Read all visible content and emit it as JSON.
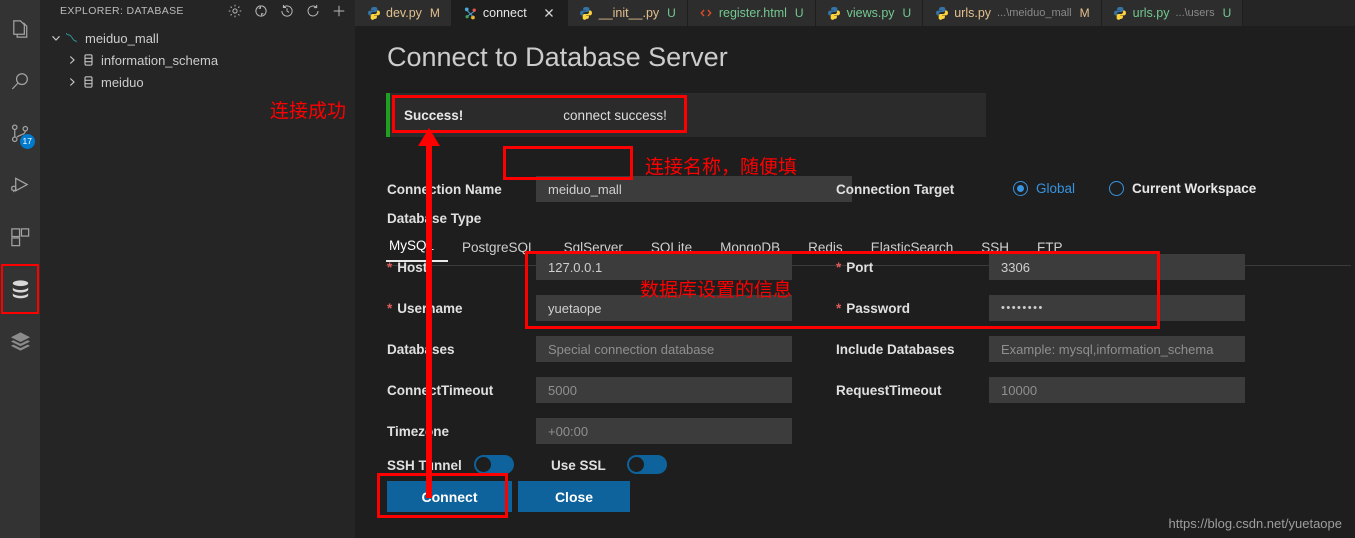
{
  "activity_bar": {
    "items": [
      {
        "name": "explorer",
        "icon": "files-icon"
      },
      {
        "name": "search",
        "icon": "search-icon"
      },
      {
        "name": "source-control",
        "icon": "source-control-icon",
        "badge": "17"
      },
      {
        "name": "run-debug",
        "icon": "run-debug-icon"
      },
      {
        "name": "extensions",
        "icon": "extensions-icon"
      },
      {
        "name": "database",
        "icon": "database-icon",
        "selected": true
      },
      {
        "name": "layers",
        "icon": "layers-icon"
      }
    ]
  },
  "sidebar": {
    "title": "EXPLORER: DATABASE",
    "actions": [
      {
        "name": "settings",
        "icon": "gear-icon"
      },
      {
        "name": "switch-connection",
        "icon": "sync-icon"
      },
      {
        "name": "history",
        "icon": "history-icon"
      },
      {
        "name": "refresh",
        "icon": "refresh-icon"
      },
      {
        "name": "add-connection",
        "icon": "plus-icon"
      }
    ],
    "tree": [
      {
        "label": "meiduo_mall",
        "level": 1,
        "expanded": true,
        "icon": "mysql-dolphin-icon"
      },
      {
        "label": "information_schema",
        "level": 2,
        "expanded": false,
        "icon": "database-cylinder-icon"
      },
      {
        "label": "meiduo",
        "level": 2,
        "expanded": false,
        "icon": "database-cylinder-icon"
      }
    ]
  },
  "tabs": [
    {
      "name": "dev.py",
      "path": "",
      "badge": "M",
      "badge_kind": "M",
      "icon": "python-icon",
      "kind": "py",
      "active": false,
      "closable": false
    },
    {
      "name": "connect",
      "path": "",
      "badge": "",
      "badge_kind": "",
      "icon": "connect-icon",
      "kind": "plain",
      "active": true,
      "closable": true
    },
    {
      "name": "__init__.py",
      "path": "",
      "badge": "U",
      "badge_kind": "U",
      "icon": "python-icon",
      "kind": "py",
      "active": false,
      "closable": false
    },
    {
      "name": "register.html",
      "path": "",
      "badge": "U",
      "badge_kind": "U",
      "icon": "html-icon",
      "kind": "html",
      "active": false,
      "closable": false
    },
    {
      "name": "views.py",
      "path": "",
      "badge": "U",
      "badge_kind": "U",
      "icon": "python-icon",
      "kind": "py",
      "active": false,
      "closable": false
    },
    {
      "name": "urls.py",
      "path": "...\\meiduo_mall",
      "badge": "M",
      "badge_kind": "M",
      "icon": "python-icon",
      "kind": "py",
      "active": false,
      "closable": false
    },
    {
      "name": "urls.py",
      "path": "...\\users",
      "badge": "U",
      "badge_kind": "U",
      "icon": "python-icon",
      "kind": "py",
      "active": false,
      "closable": false
    }
  ],
  "form": {
    "title": "Connect to Database Server",
    "alert": {
      "title": "Success!",
      "message": "connect success!"
    },
    "connection_name": {
      "label": "Connection Name",
      "value": "meiduo_mall"
    },
    "connection_target": {
      "label": "Connection Target",
      "options": [
        {
          "label": "Global",
          "selected": true
        },
        {
          "label": "Current Workspace",
          "selected": false
        }
      ]
    },
    "database_type": {
      "label": "Database Type",
      "tabs": [
        "MySQL",
        "PostgreSQL",
        "SqlServer",
        "SQLite",
        "MongoDB",
        "Redis",
        "ElasticSearch",
        "SSH",
        "FTP"
      ],
      "selected": "MySQL"
    },
    "fields": [
      {
        "label": "Host",
        "required": true,
        "value": "127.0.0.1",
        "placeholder": ""
      },
      {
        "label": "Port",
        "required": true,
        "value": "3306",
        "placeholder": ""
      },
      {
        "label": "Username",
        "required": true,
        "value": "yuetaope",
        "placeholder": ""
      },
      {
        "label": "Password",
        "required": true,
        "value": "••••••••",
        "placeholder": ""
      },
      {
        "label": "Databases",
        "required": false,
        "value": "",
        "placeholder": "Special connection database"
      },
      {
        "label": "Include Databases",
        "required": false,
        "value": "",
        "placeholder": "Example: mysql,information_schema"
      },
      {
        "label": "ConnectTimeout",
        "required": false,
        "value": "5000",
        "placeholder": ""
      },
      {
        "label": "RequestTimeout",
        "required": false,
        "value": "10000",
        "placeholder": ""
      },
      {
        "label": "Timezone",
        "required": false,
        "value": "+00:00",
        "placeholder": ""
      }
    ],
    "toggles": [
      {
        "label": "SSH Tunnel",
        "on": false
      },
      {
        "label": "Use SSL",
        "on": false
      }
    ],
    "buttons": [
      {
        "label": "Connect",
        "primary": true
      },
      {
        "label": "Close",
        "primary": true
      }
    ]
  },
  "annotations": {
    "connect_success": "连接成功",
    "connection_name_note": "连接名称，随便填",
    "db_settings_note": "数据库设置的信息"
  },
  "watermark": "https://blog.csdn.net/yuetaope",
  "colors": {
    "accent": "#0e639c",
    "annotation_red": "#fe0000",
    "success_green": "#20a020",
    "radio_blue": "#3794e0",
    "modified_badge": "#e2c08d",
    "untracked_badge": "#73c991"
  }
}
